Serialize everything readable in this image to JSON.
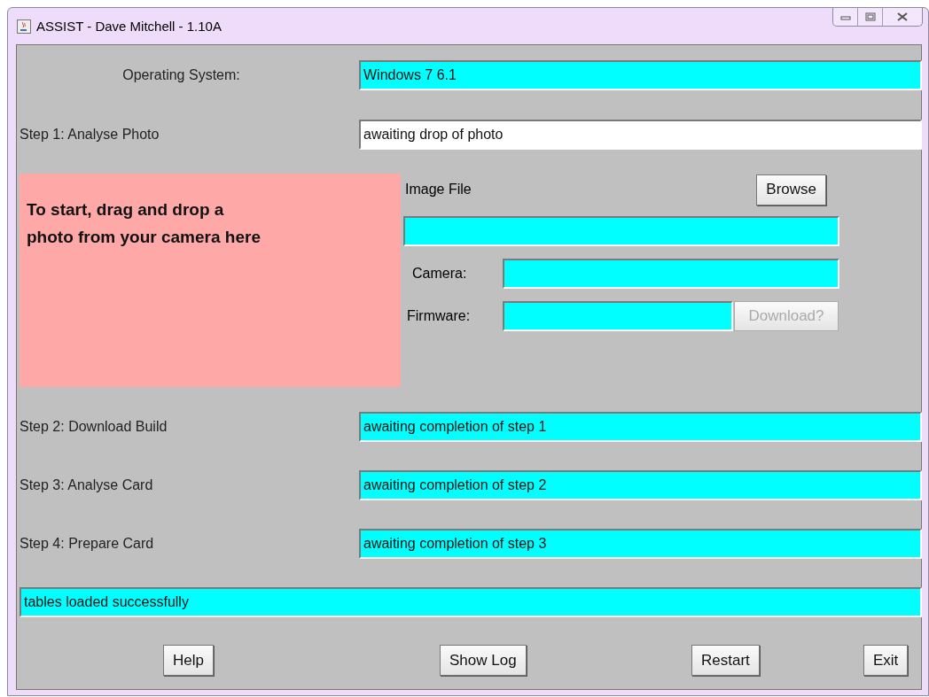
{
  "window": {
    "title": "ASSIST - Dave Mitchell - 1.10A"
  },
  "os": {
    "label": "Operating System:",
    "value": "Windows 7 6.1",
    "color": "#00ffff"
  },
  "step1": {
    "label": "Step 1: Analyse Photo",
    "value": "awaiting drop of photo",
    "color": "#ffffff"
  },
  "drop_zone": {
    "text": "To start, drag and drop a photo from your camera here"
  },
  "image_file": {
    "label": "Image File",
    "button": {
      "label": "Browse",
      "disabled": false
    },
    "color": "#00ffff"
  },
  "camera": {
    "label": "Camera:",
    "color": "#00ffff"
  },
  "firmware": {
    "label": "Firmware:",
    "color": "#00ffff",
    "button": {
      "label": "Download?",
      "disabled": true
    }
  },
  "steps": [
    {
      "label": "Step 2: Download Build",
      "value": "awaiting completion of step 1",
      "color": "#00ffff"
    },
    {
      "label": "Step 3: Analyse Card",
      "value": "awaiting completion of step 2",
      "color": "#00ffff"
    },
    {
      "label": "Step 4: Prepare Card",
      "value": "awaiting completion of step 3",
      "color": "#00ffff"
    }
  ],
  "status": {
    "value": "tables loaded successfully",
    "color": "#00ffff"
  },
  "buttons": [
    {
      "label": "Help",
      "disabled": false
    },
    {
      "label": "Show Log",
      "disabled": false
    },
    {
      "label": "Restart",
      "disabled": false
    },
    {
      "label": "Exit",
      "disabled": false
    }
  ]
}
